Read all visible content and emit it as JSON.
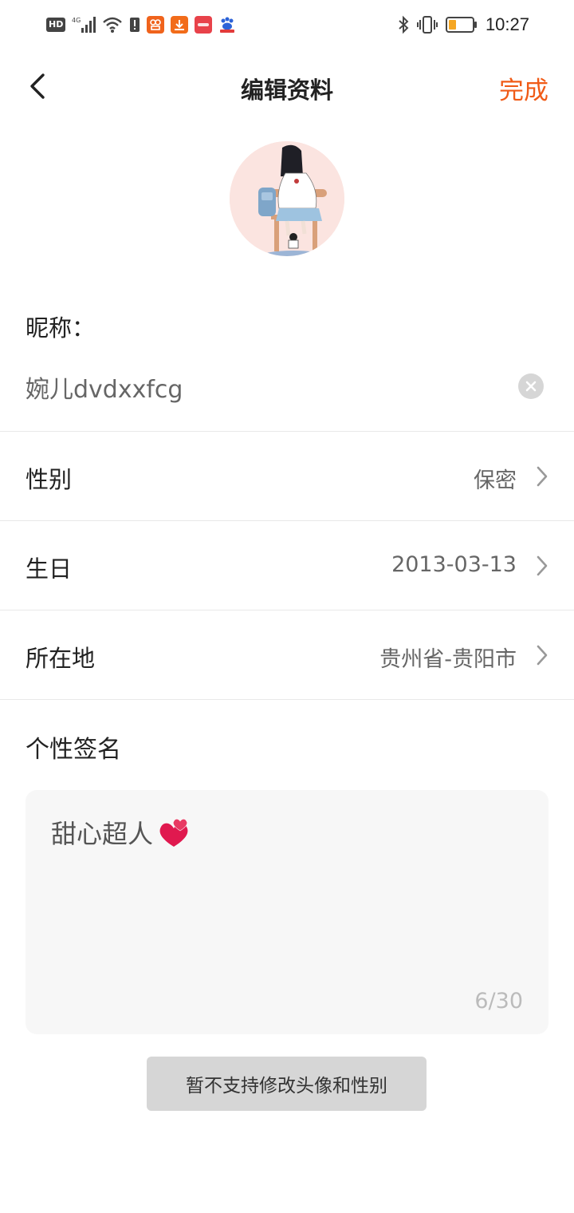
{
  "status_bar": {
    "hd_badge": "HD",
    "network": "4G",
    "time": "10:27",
    "icons": [
      "signal-icon",
      "wifi-icon",
      "alert-icon",
      "app-icon-orange",
      "download-icon",
      "app-icon-red",
      "baidu-icon",
      "bluetooth-icon",
      "vibrate-icon",
      "battery-icon"
    ],
    "colors": {
      "battery_level": "#f5a623"
    }
  },
  "header": {
    "title": "编辑资料",
    "done_label": "完成",
    "colors": {
      "accent": "#f05b17"
    }
  },
  "profile": {
    "nickname_label": "昵称：",
    "nickname_value": "婉儿dvdxxfcg",
    "rows": [
      {
        "label": "性别",
        "value": "保密"
      },
      {
        "label": "生日",
        "value": "2013-03-13"
      },
      {
        "label": "所在地",
        "value": "贵州省-贵阳市"
      }
    ],
    "signature_label": "个性签名",
    "signature_text": "甜心超人",
    "signature_emoji": "two-hearts-icon",
    "signature_counter": "6/30",
    "notice": "暂不支持修改头像和性别"
  }
}
